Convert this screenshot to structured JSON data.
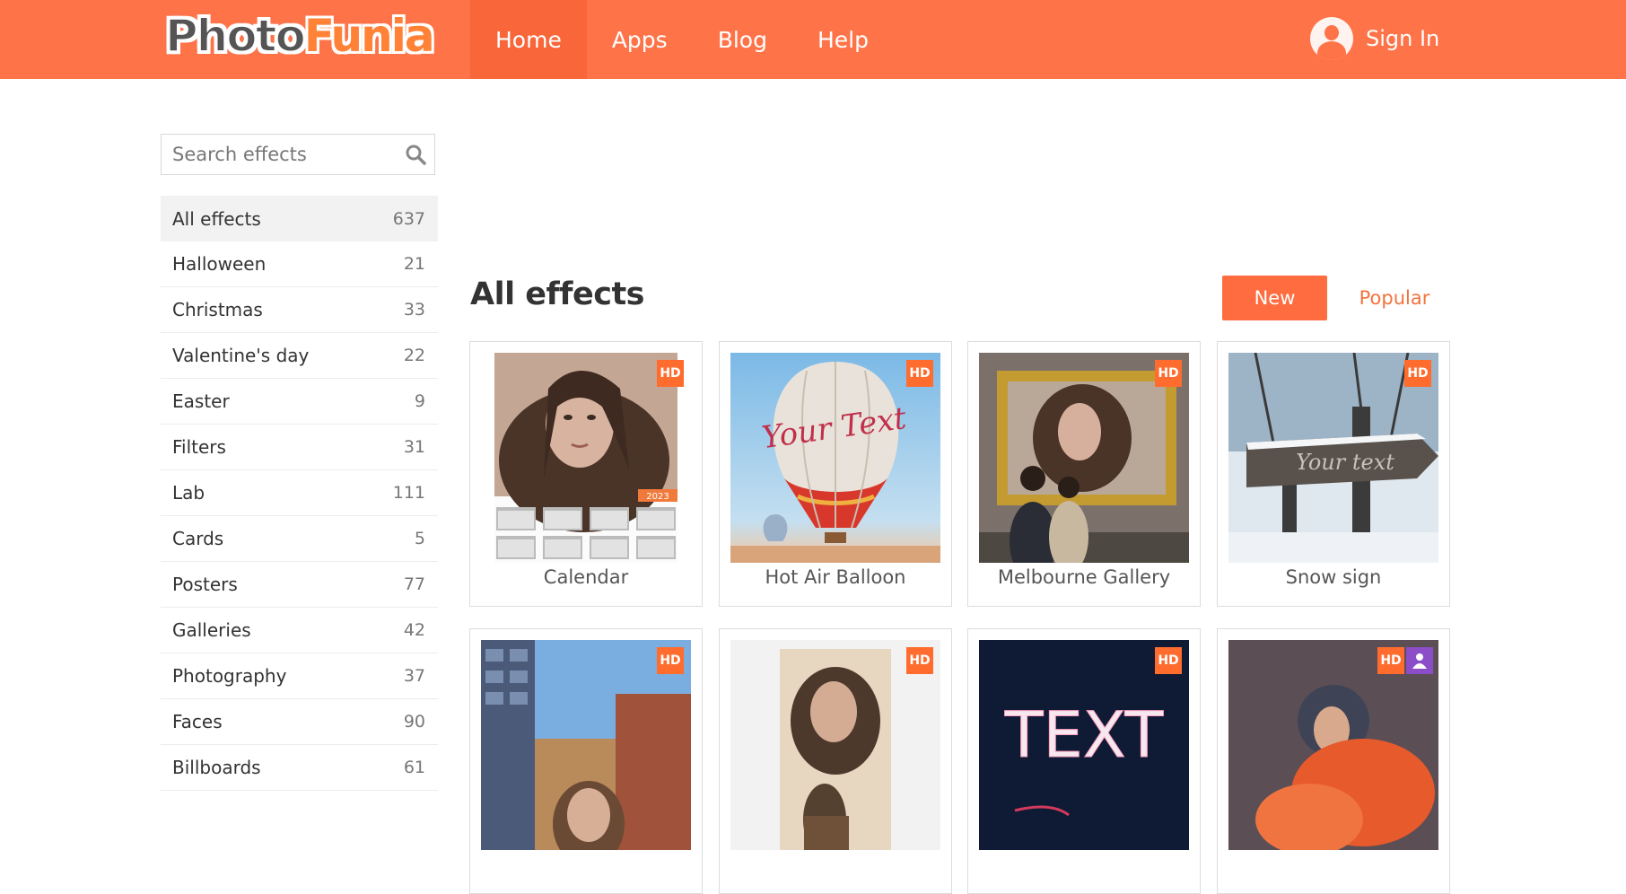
{
  "header": {
    "logo_part1": "Photo",
    "logo_part2": "Funia",
    "nav": [
      {
        "label": "Home"
      },
      {
        "label": "Apps"
      },
      {
        "label": "Blog"
      },
      {
        "label": "Help"
      }
    ],
    "signin_label": "Sign In"
  },
  "search": {
    "placeholder": "Search effects"
  },
  "categories": [
    {
      "label": "All effects",
      "count": "637"
    },
    {
      "label": "Halloween",
      "count": "21"
    },
    {
      "label": "Christmas",
      "count": "33"
    },
    {
      "label": "Valentine's day",
      "count": "22"
    },
    {
      "label": "Easter",
      "count": "9"
    },
    {
      "label": "Filters",
      "count": "31"
    },
    {
      "label": "Lab",
      "count": "111"
    },
    {
      "label": "Cards",
      "count": "5"
    },
    {
      "label": "Posters",
      "count": "77"
    },
    {
      "label": "Galleries",
      "count": "42"
    },
    {
      "label": "Photography",
      "count": "37"
    },
    {
      "label": "Faces",
      "count": "90"
    },
    {
      "label": "Billboards",
      "count": "61"
    }
  ],
  "main": {
    "title": "All effects",
    "sort_new": "New",
    "sort_popular": "Popular",
    "badge_hd": "HD",
    "calendar_year": "2023",
    "balloon_text": "Your Text",
    "sign_text": "Your text",
    "neon_text": "TEXT",
    "cards": [
      {
        "name": "Calendar"
      },
      {
        "name": "Hot Air Balloon"
      },
      {
        "name": "Melbourne Gallery"
      },
      {
        "name": "Snow sign"
      },
      {
        "name": ""
      },
      {
        "name": ""
      },
      {
        "name": ""
      },
      {
        "name": ""
      }
    ]
  },
  "colors": {
    "brand": "#ff7349",
    "accent": "#ff6c40",
    "hd_badge": "#ff6c2e",
    "user_badge": "#8b4dc8"
  }
}
